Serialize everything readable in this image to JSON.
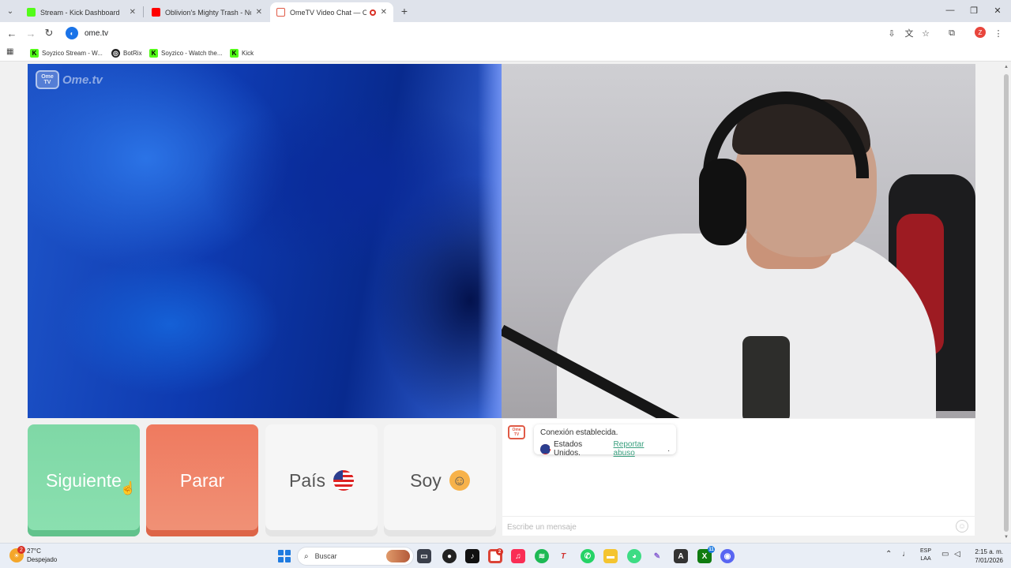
{
  "browser": {
    "tabs": [
      {
        "title": "Stream - Kick Dashboard",
        "active": false
      },
      {
        "title": "Oblivion's Mighty Trash - No M",
        "active": false
      },
      {
        "title": "OmeTV Video Chat — Ome",
        "active": true
      }
    ],
    "url": "ome.tv",
    "profile_initial": "Z",
    "bookmarks": [
      {
        "label": "Soyzico Stream - W..."
      },
      {
        "label": "BotRix"
      },
      {
        "label": "Soyzico - Watch the..."
      },
      {
        "label": "Kick"
      }
    ]
  },
  "ometv": {
    "logo_text": "Ome.tv",
    "logo_badge": "Ome TV",
    "buttons": {
      "next": "Siguiente",
      "stop": "Parar",
      "country": "País",
      "gender": "Soy"
    },
    "chat": {
      "avatar_text": "Ome TV",
      "status_message": "Conexión establecida.",
      "country_name": "Estados Unidos.",
      "report_link": "Reportar abuso",
      "report_suffix": ".",
      "input_placeholder": "Escribe un mensaje"
    }
  },
  "taskbar": {
    "weather_temp": "27°C",
    "weather_desc": "Despejado",
    "weather_badge": "2",
    "search_placeholder": "Buscar",
    "chrome_badge": "2",
    "xbox_badge": "11",
    "lang_line1": "ESP",
    "lang_line2": "LAA",
    "time": "2:15 a. m.",
    "date": "7/01/2026"
  },
  "colors": {
    "next_button": "#7fd8a6",
    "stop_button": "#ef7a5f",
    "report_link": "#3aa07f",
    "logo_red": "#e05a46"
  }
}
